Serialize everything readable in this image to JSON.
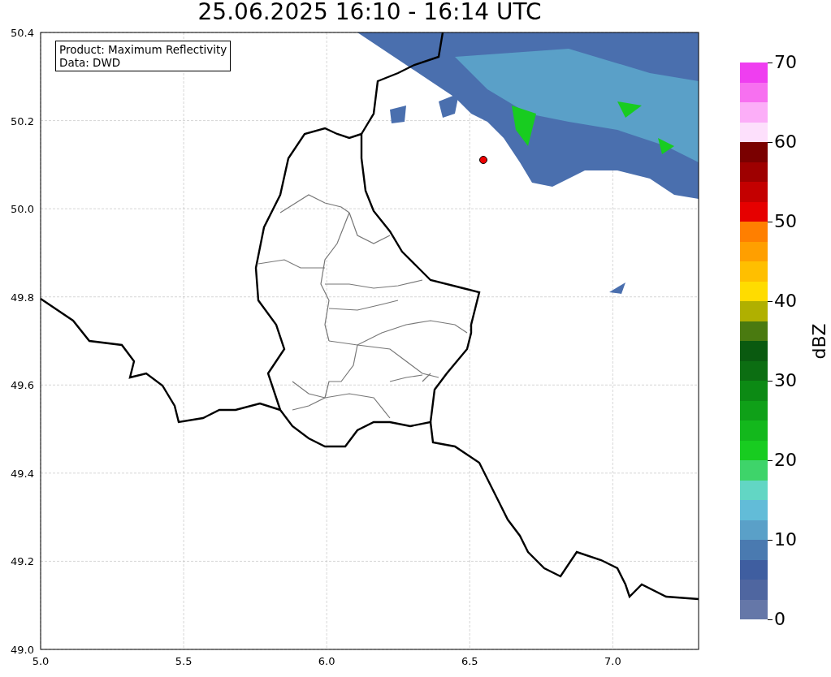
{
  "title": "25.06.2025 16:10 - 16:14 UTC",
  "legend_lines": [
    "Product: Maximum Reflectivity",
    "Data: DWD"
  ],
  "x_ticks": [
    "5.0",
    "5.5",
    "6.0",
    "6.5",
    "7.0"
  ],
  "y_ticks": [
    "50.4",
    "50.2",
    "50.0",
    "49.8",
    "49.6",
    "49.4",
    "49.2",
    "49.0"
  ],
  "colorbar": {
    "label": "dBZ",
    "ticks": [
      "70",
      "60",
      "50",
      "40",
      "30",
      "20",
      "10",
      "0"
    ],
    "segments": [
      {
        "color": "#ef3ef0"
      },
      {
        "color": "#f770f0"
      },
      {
        "color": "#fcaef8"
      },
      {
        "color": "#fde0fc"
      },
      {
        "color": "#7a0000"
      },
      {
        "color": "#9e0000"
      },
      {
        "color": "#c40000"
      },
      {
        "color": "#e60000"
      },
      {
        "color": "#ff7f00"
      },
      {
        "color": "#ff9f00"
      },
      {
        "color": "#ffbf00"
      },
      {
        "color": "#ffdc00"
      },
      {
        "color": "#b0b000"
      },
      {
        "color": "#4a7a10"
      },
      {
        "color": "#0a5a10"
      },
      {
        "color": "#0c6e12"
      },
      {
        "color": "#0c8a14"
      },
      {
        "color": "#0fa018"
      },
      {
        "color": "#13b81c"
      },
      {
        "color": "#18cc20"
      },
      {
        "color": "#3ed46a"
      },
      {
        "color": "#62d6c4"
      },
      {
        "color": "#62bcd8"
      },
      {
        "color": "#5aa0c8"
      },
      {
        "color": "#4a7ab0"
      },
      {
        "color": "#3f5ea0"
      },
      {
        "color": "#4f66a0"
      },
      {
        "color": "#6577a8"
      }
    ]
  }
}
